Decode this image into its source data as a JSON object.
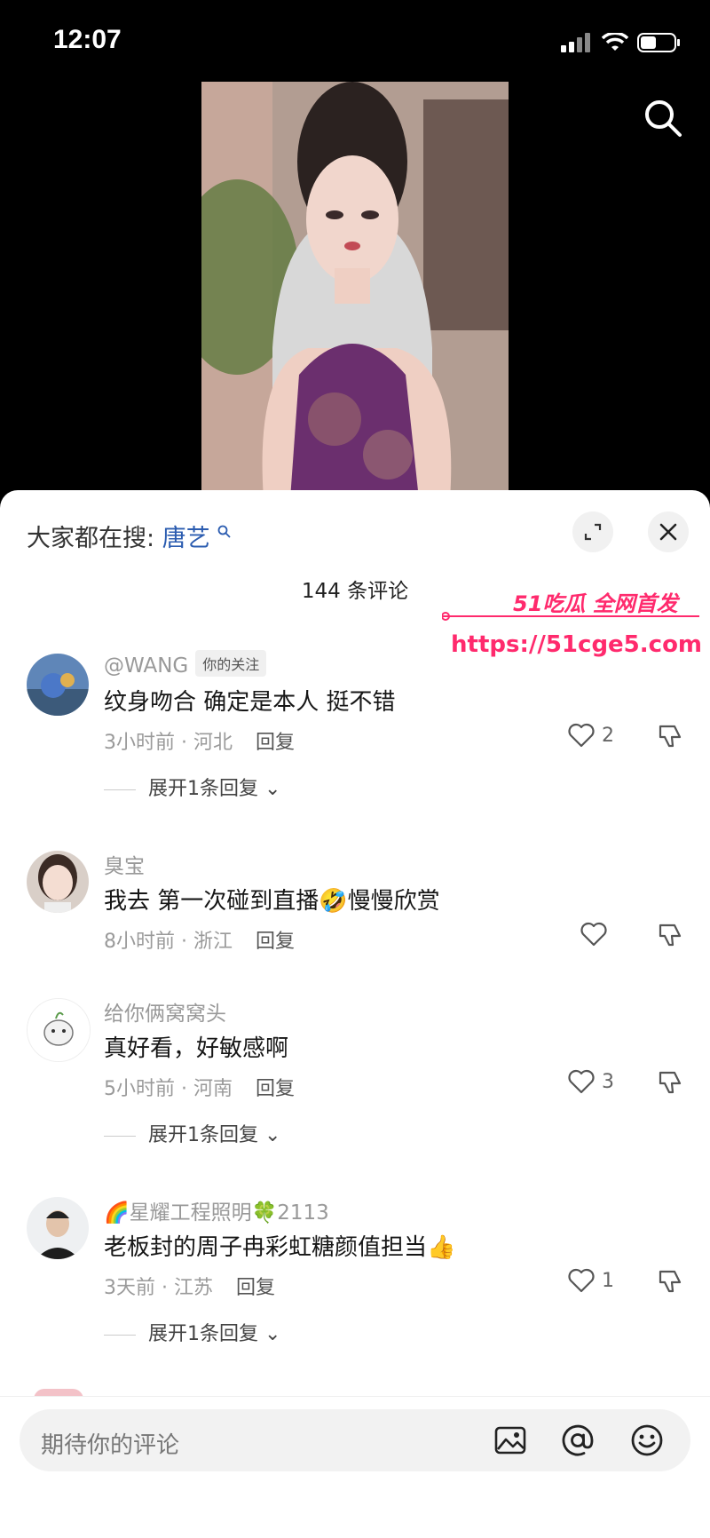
{
  "status": {
    "time": "12:07"
  },
  "sheet": {
    "hot_search_prefix": "大家都在搜:",
    "hot_search_keyword": "唐艺",
    "comment_count": "144 条评论"
  },
  "watermark": {
    "line1": "51吃瓜 全网首发",
    "line2": "https://51cge5.com"
  },
  "comments": [
    {
      "user": "@WANG",
      "tag": "你的关注",
      "text": "纹身吻合 确定是本人 挺不错",
      "time": "3小时前 · 河北",
      "reply": "回复",
      "likes": "2",
      "expand": "展开1条回复"
    },
    {
      "user": "臭宝",
      "text": "我去 第一次碰到直播🤣慢慢欣赏",
      "time": "8小时前 · 浙江",
      "reply": "回复",
      "likes": ""
    },
    {
      "user": "给你俩窝窝头",
      "text": "真好看，好敏感啊",
      "time": "5小时前 · 河南",
      "reply": "回复",
      "likes": "3",
      "expand": "展开1条回复"
    },
    {
      "user": "🌈星耀工程照明🍀2113",
      "text": "老板封的周子冉彩虹糖颜值担当👍",
      "time": "3天前 · 江苏",
      "reply": "回复",
      "likes": "1",
      "expand": "展开1条回复"
    }
  ],
  "input": {
    "placeholder": "期待你的评论"
  },
  "icons": [
    "search-icon",
    "expand-icon",
    "close-icon",
    "heart-icon",
    "dislike-icon",
    "image-icon",
    "at-icon",
    "emoji-icon",
    "signal-icon",
    "wifi-icon",
    "battery-icon"
  ]
}
